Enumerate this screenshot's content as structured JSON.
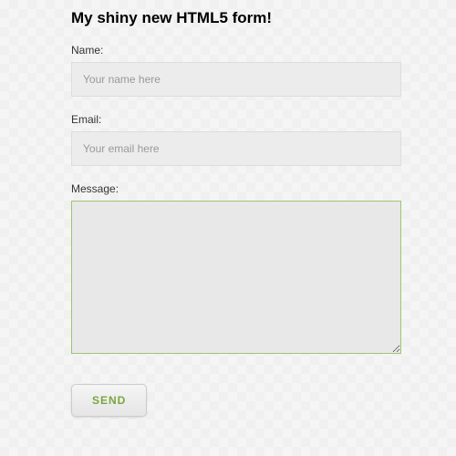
{
  "form": {
    "title": "My shiny new HTML5 form!",
    "name": {
      "label": "Name:",
      "placeholder": "Your name here",
      "value": ""
    },
    "email": {
      "label": "Email:",
      "placeholder": "Your email here",
      "value": ""
    },
    "message": {
      "label": "Message:",
      "value": ""
    },
    "submit_label": "SEND"
  }
}
